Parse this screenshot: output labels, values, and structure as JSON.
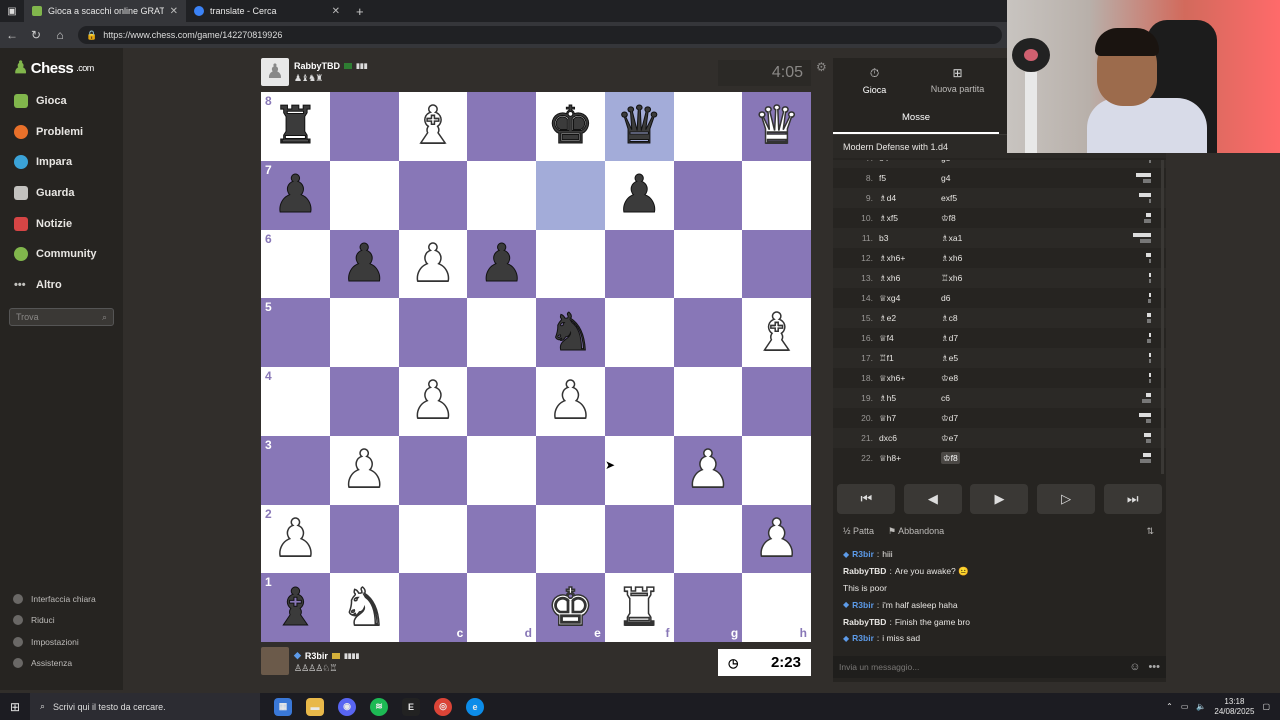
{
  "browser": {
    "tabs": [
      {
        "title": "Gioca a scacchi online GRATIS",
        "active": true
      },
      {
        "title": "translate - Cerca",
        "active": false
      }
    ],
    "url": "https://www.chess.com/game/142270819926"
  },
  "sidebar": {
    "logo": "Chess",
    "logo_domain": ".com",
    "items": [
      {
        "label": "Gioca",
        "icon": "play-icon",
        "color": "#81b64c"
      },
      {
        "label": "Problemi",
        "icon": "puzzle-icon",
        "color": "#e8702a"
      },
      {
        "label": "Impara",
        "icon": "learn-icon",
        "color": "#3ba3d8"
      },
      {
        "label": "Guarda",
        "icon": "watch-icon",
        "color": "#c3c2bf"
      },
      {
        "label": "Notizie",
        "icon": "news-icon",
        "color": "#d64545"
      },
      {
        "label": "Community",
        "icon": "community-icon",
        "color": "#81b64c"
      },
      {
        "label": "Altro",
        "icon": "more-icon",
        "color": "#c3c2bf"
      }
    ],
    "search_placeholder": "Trova",
    "bottom": [
      {
        "label": "Interfaccia chiara",
        "icon": "theme-icon"
      },
      {
        "label": "Riduci",
        "icon": "collapse-icon"
      },
      {
        "label": "Impostazioni",
        "icon": "settings-icon"
      },
      {
        "label": "Assistenza",
        "icon": "help-icon"
      }
    ]
  },
  "top_player": {
    "name": "RabbyTBD",
    "captured": "♟♝♞♜",
    "clock": "4:05"
  },
  "bottom_player": {
    "name": "R3bir",
    "captured": "♙♙♙♙♘♖",
    "clock": "2:23"
  },
  "board": {
    "rows": [
      [
        "bR",
        "",
        "wB",
        "",
        "bK",
        "bQ",
        "",
        "wQ"
      ],
      [
        "bP",
        "",
        "",
        "",
        "",
        "bP",
        "",
        ""
      ],
      [
        "",
        "bP",
        "wP",
        "bP",
        "",
        "",
        "",
        ""
      ],
      [
        "",
        "",
        "",
        "",
        "bN",
        "",
        "",
        "wB"
      ],
      [
        "",
        "",
        "wP",
        "",
        "wP",
        "",
        "",
        ""
      ],
      [
        "",
        "wP",
        "",
        "",
        "",
        "",
        "wP",
        ""
      ],
      [
        "wP",
        "",
        "",
        "",
        "",
        "",
        "",
        "wP"
      ],
      [
        "bB",
        "wN",
        "",
        "",
        "wK",
        "wR",
        "",
        ""
      ]
    ],
    "ranks": [
      "8",
      "7",
      "6",
      "5",
      "4",
      "3",
      "2",
      "1"
    ],
    "files": [
      "",
      "",
      "c",
      "d",
      "e",
      "f",
      "g",
      "h"
    ],
    "highlight": [
      [
        0,
        5
      ],
      [
        1,
        4
      ]
    ],
    "colors": {
      "light": "#ffffff",
      "dark": "#8877b7",
      "highlight": "#a3acd9"
    }
  },
  "panel": {
    "tabs": [
      {
        "label": "Gioca",
        "icon": "timer-icon"
      },
      {
        "label": "Nuova partita",
        "icon": "plus-icon"
      }
    ],
    "subtab": "Mosse",
    "opening": "Modern Defense with 1.d4",
    "moves": [
      {
        "num": "7.",
        "w": "e4",
        "b": "g5",
        "wt": [
          4.9,
          0.5
        ],
        "bt": [
          0,
          0
        ]
      },
      {
        "num": "8.",
        "w": "f5",
        "b": "g4",
        "wt": [
          59.9,
          33.3
        ],
        "bt": [
          0,
          0
        ]
      },
      {
        "num": "9.",
        "w": "♗d4",
        "b": "exf5",
        "wt": [
          49.7,
          9.7
        ],
        "bt": [
          0,
          0
        ]
      },
      {
        "num": "10.",
        "w": "♗xf5",
        "b": "♔f8",
        "wt": [
          18.9,
          27.2
        ],
        "bt": [
          0,
          0
        ]
      },
      {
        "num": "11.",
        "w": "b3",
        "b": "♗xa1",
        "wt": [
          86,
          42.8
        ],
        "bt": [
          0,
          0
        ]
      },
      {
        "num": "12.",
        "w": "♗xh6+",
        "b": "♗xh6",
        "wt": [
          21.3,
          5.5
        ],
        "bt": [
          0,
          0
        ]
      },
      {
        "num": "13.",
        "w": "♗xh6",
        "b": "♖xh6",
        "wt": [
          6.0,
          1.8
        ],
        "bt": [
          0,
          0
        ]
      },
      {
        "num": "14.",
        "w": "♕xg4",
        "b": "d6",
        "wt": [
          1.8,
          13.5
        ],
        "bt": [
          0,
          0
        ]
      },
      {
        "num": "15.",
        "w": "♗e2",
        "b": "♗c8",
        "wt": [
          16.2,
          15.6
        ],
        "bt": [
          0,
          0
        ]
      },
      {
        "num": "16.",
        "w": "♕f4",
        "b": "♗d7",
        "wt": [
          9.5,
          14.2
        ],
        "bt": [
          0,
          0
        ]
      },
      {
        "num": "17.",
        "w": "♖f1",
        "b": "♗e5",
        "wt": [
          6.3,
          4.3
        ],
        "bt": [
          0,
          0
        ]
      },
      {
        "num": "18.",
        "w": "♕xh6+",
        "b": "♔e8",
        "wt": [
          5.2,
          6.1
        ],
        "bt": [
          0,
          0
        ]
      },
      {
        "num": "19.",
        "w": "♗h5",
        "b": "c6",
        "wt": [
          20.7,
          35.1
        ],
        "bt": [
          0,
          0
        ]
      },
      {
        "num": "20.",
        "w": "♕h7",
        "b": "♔d7",
        "wt": [
          49.2,
          20.4
        ],
        "bt": [
          0,
          0
        ]
      },
      {
        "num": "21.",
        "w": "dxc6",
        "b": "♔e7",
        "wt": [
          26.6,
          20.6
        ],
        "bt": [
          0,
          0
        ]
      },
      {
        "num": "22.",
        "w": "♕h8+",
        "b": "♔f8",
        "wt": [
          31.8,
          42.1
        ],
        "bt": [
          0,
          0
        ]
      }
    ],
    "times": [
      "4.9s",
      "59.9s",
      "33.3s",
      "49.7s",
      "9.7s",
      "18.9s",
      "27.2s",
      "1m 26s",
      "42.8s",
      "21.3s",
      "5.5s",
      "6.0s",
      "1.8s",
      "1.8s",
      "13.5s",
      "16.2s",
      "15.6s",
      "9.5s",
      "14.2s",
      "6.3s",
      "4.3s",
      "5.2s",
      "6.1s",
      "20.7s",
      "35.1s",
      "49.2s",
      "20.4s",
      "26.6s",
      "20.6s",
      "31.8s",
      "42.1s"
    ],
    "controls": [
      "⏮",
      "◀",
      "▶",
      "▷",
      "⏭"
    ],
    "actions": {
      "draw": "Patta",
      "resign": "Abbandona"
    },
    "chat": [
      {
        "author": "R3bir",
        "text": "hiii",
        "gem": true
      },
      {
        "author": "RabbyTBD",
        "text": "Are you awake? 😐",
        "gem": false
      },
      {
        "author": "",
        "text": "This is poor",
        "gem": false
      },
      {
        "author": "R3bir",
        "text": "i'm half asleep haha",
        "gem": true
      },
      {
        "author": "RabbyTBD",
        "text": "Finish the game bro",
        "gem": false
      },
      {
        "author": "R3bir",
        "text": "i miss sad",
        "gem": true
      }
    ],
    "chat_placeholder": "Invia un messaggio..."
  },
  "taskbar": {
    "search": "Scrivi qui il testo da cercare.",
    "time": "13:18",
    "date": "24/08/2025"
  }
}
